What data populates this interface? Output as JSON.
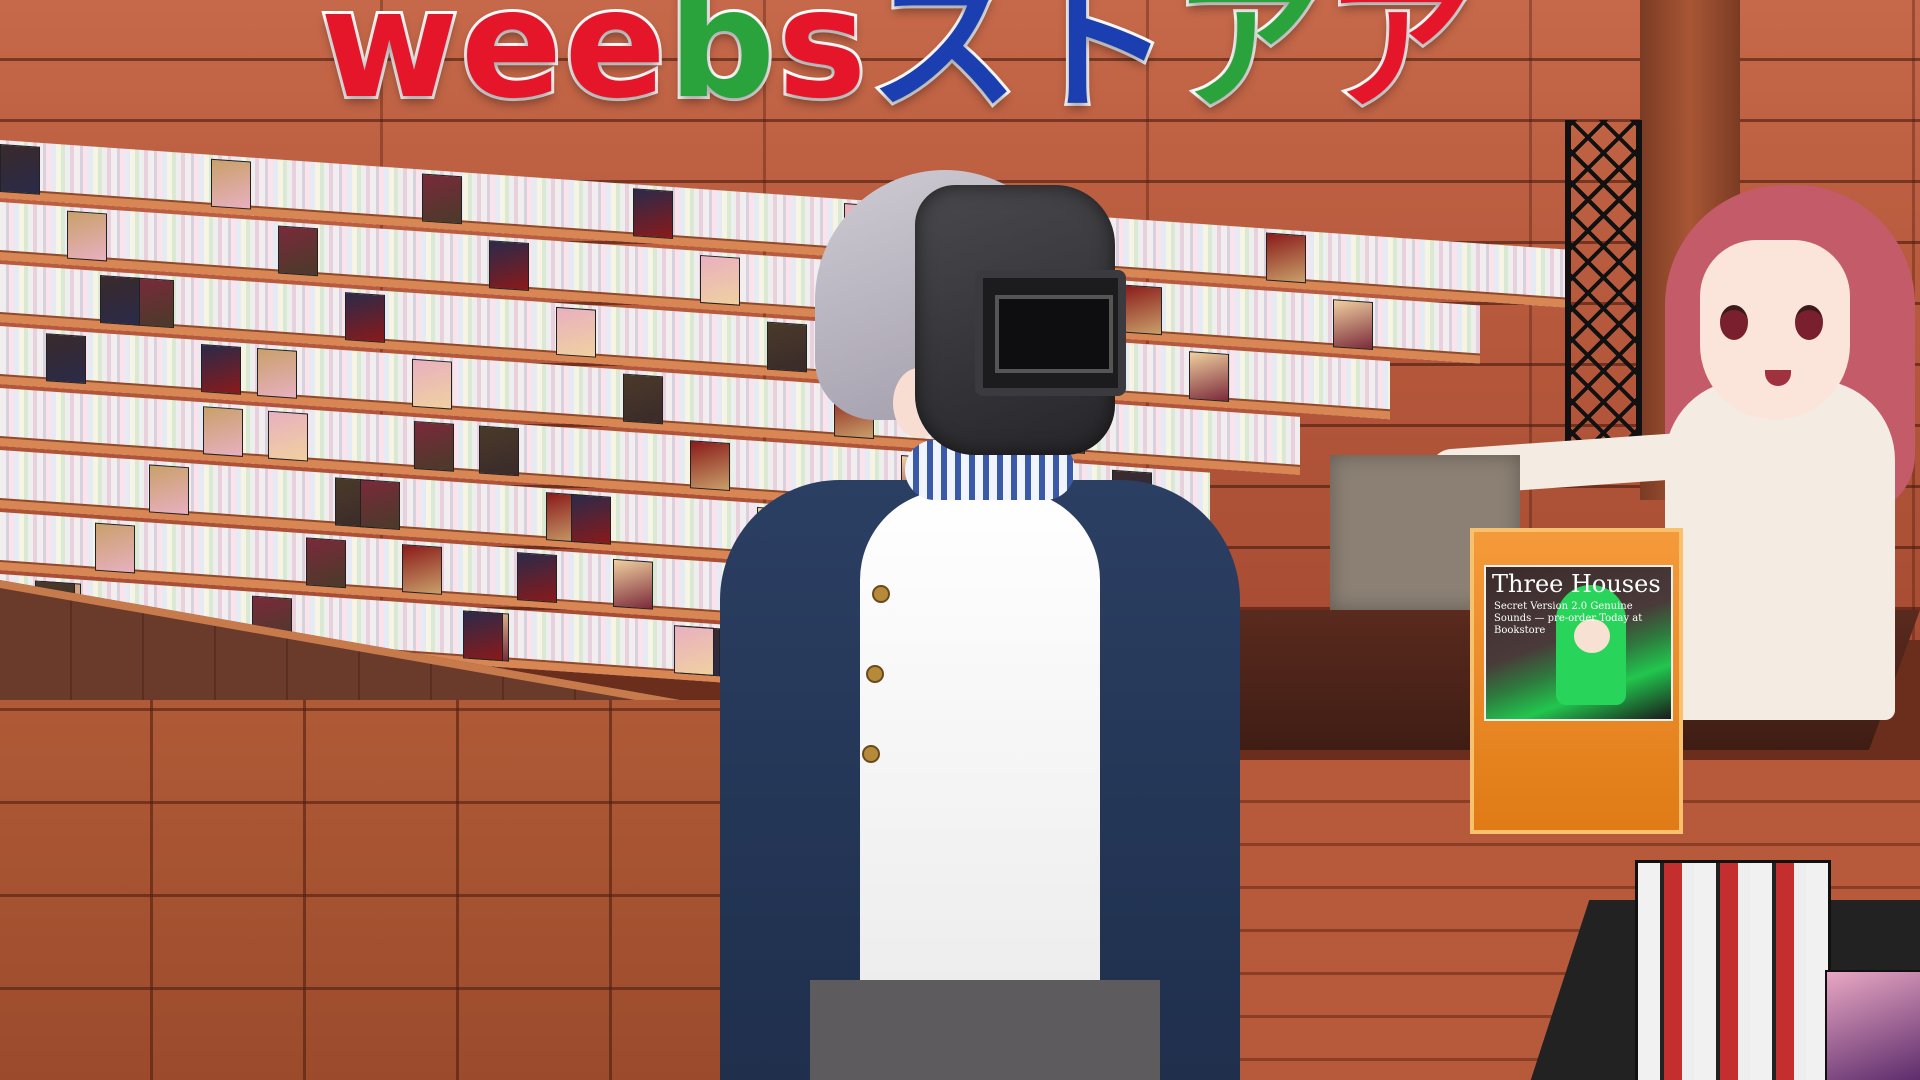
{
  "sign": {
    "letters": [
      {
        "char": "w",
        "color": "#e5162a"
      },
      {
        "char": "e",
        "color": "#e5162a"
      },
      {
        "char": "e",
        "color": "#e5162a"
      },
      {
        "char": "b",
        "color": "#2aa33c"
      },
      {
        "char": "s",
        "color": "#e5162a"
      },
      {
        "char": "ス",
        "color": "#1b3fb0"
      },
      {
        "char": "ト",
        "color": "#1b3fb0"
      },
      {
        "char": "ア",
        "color": "#2aa33c"
      },
      {
        "char": "ア",
        "color": "#e5162a"
      }
    ]
  },
  "display_poster": {
    "title": "Three Houses",
    "subtitle": "Secret Version 2.0 Genuine Sounds — pre-order Today at Bookstore"
  },
  "colors": {
    "jacket": "#2b3f63",
    "clerk_hair": "#c35b68",
    "stand": "#f59a3a"
  }
}
